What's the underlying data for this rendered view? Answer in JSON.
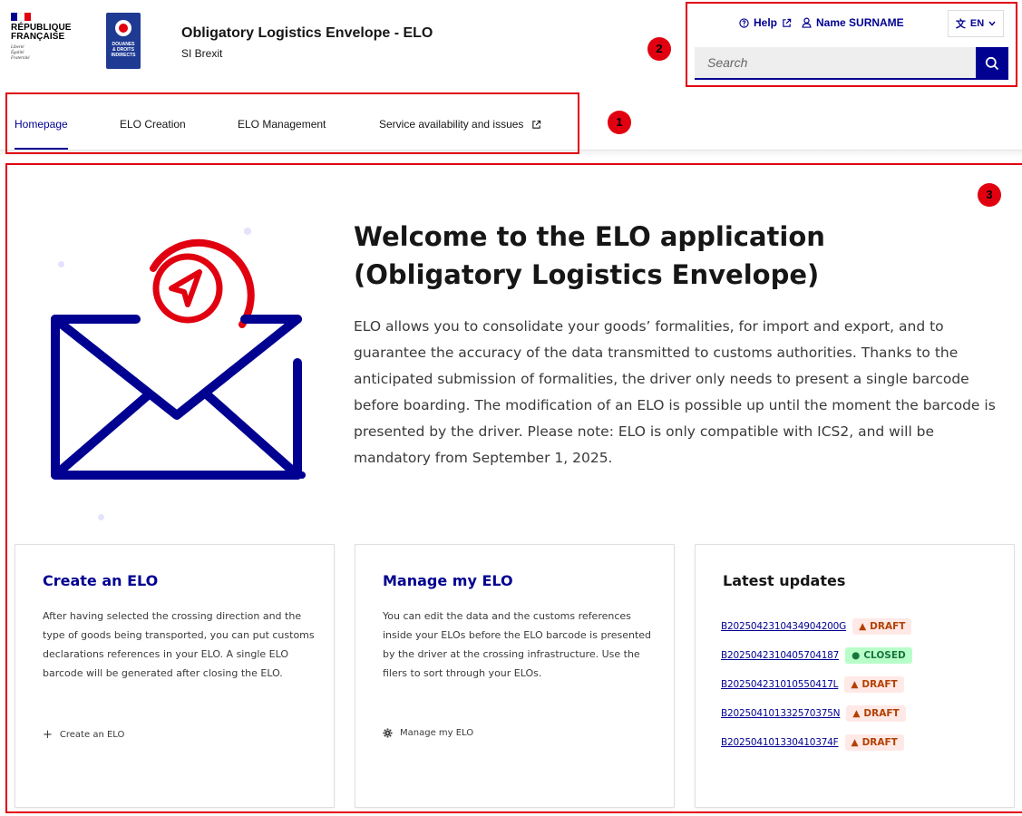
{
  "header": {
    "republic_line1": "RÉPUBLIQUE",
    "republic_line2": "FRANÇAISE",
    "motto": [
      "Liberté",
      "Égalité",
      "Fraternité"
    ],
    "douane_logo_lines": [
      "DOUANES",
      "& DROITS",
      "INDIRECTS"
    ],
    "service_title": "Obligatory Logistics Envelope - ELO",
    "service_tagline": "SI Brexit"
  },
  "tools": {
    "help_label": "Help",
    "user_label": "Name SURNAME",
    "language": "EN",
    "search_placeholder": "Search"
  },
  "nav": {
    "items": [
      {
        "label": "Homepage",
        "active": true
      },
      {
        "label": "ELO Creation",
        "active": false
      },
      {
        "label": "ELO Management",
        "active": false
      },
      {
        "label": "Service availability and issues",
        "active": false,
        "external": true
      }
    ]
  },
  "markers": [
    "1",
    "2",
    "3"
  ],
  "welcome": {
    "title": "Welcome to the ELO application (Obligatory Logistics Envelope)",
    "text": "ELO allows you to consolidate your goods’ formalities, for import and export, and to guarantee the accuracy of the data transmitted to customs authorities. Thanks to the anticipated submission of formalities, the driver only needs to present a single barcode before boarding. The modification of an ELO is possible up until the moment the barcode is presented by the driver. Please note: ELO is only compatible with ICS2, and will be mandatory from September 1, 2025."
  },
  "cards": {
    "create": {
      "title": "Create an ELO",
      "description": "After having selected the crossing direction and the type of goods being transported, you can put customs declarations references in your ELO. A single ELO barcode will be generated after closing the ELO.",
      "link_label": "Create an ELO"
    },
    "manage": {
      "title": "Manage my ELO",
      "description": "You can edit the data and the customs references inside your ELOs before the ELO barcode is presented by the driver at the crossing infrastructure. Use the filers to sort through your ELOs.",
      "link_label": "Manage my ELO"
    },
    "updates": {
      "title": "Latest updates",
      "items": [
        {
          "id": "B2025042310434904200G",
          "status": "DRAFT"
        },
        {
          "id": "B2025042310405704187",
          "status": "CLOSED"
        },
        {
          "id": "B202504231010550417L",
          "status": "DRAFT"
        },
        {
          "id": "B202504101332570375N",
          "status": "DRAFT"
        },
        {
          "id": "B202504101330410374F",
          "status": "DRAFT"
        }
      ]
    }
  },
  "colors": {
    "primary_blue": "#000091",
    "marianne_red": "#e1000f",
    "draft_bg": "#ffe9e6",
    "draft_fg": "#b34000",
    "closed_bg": "#b8fec9",
    "closed_fg": "#18753c"
  }
}
